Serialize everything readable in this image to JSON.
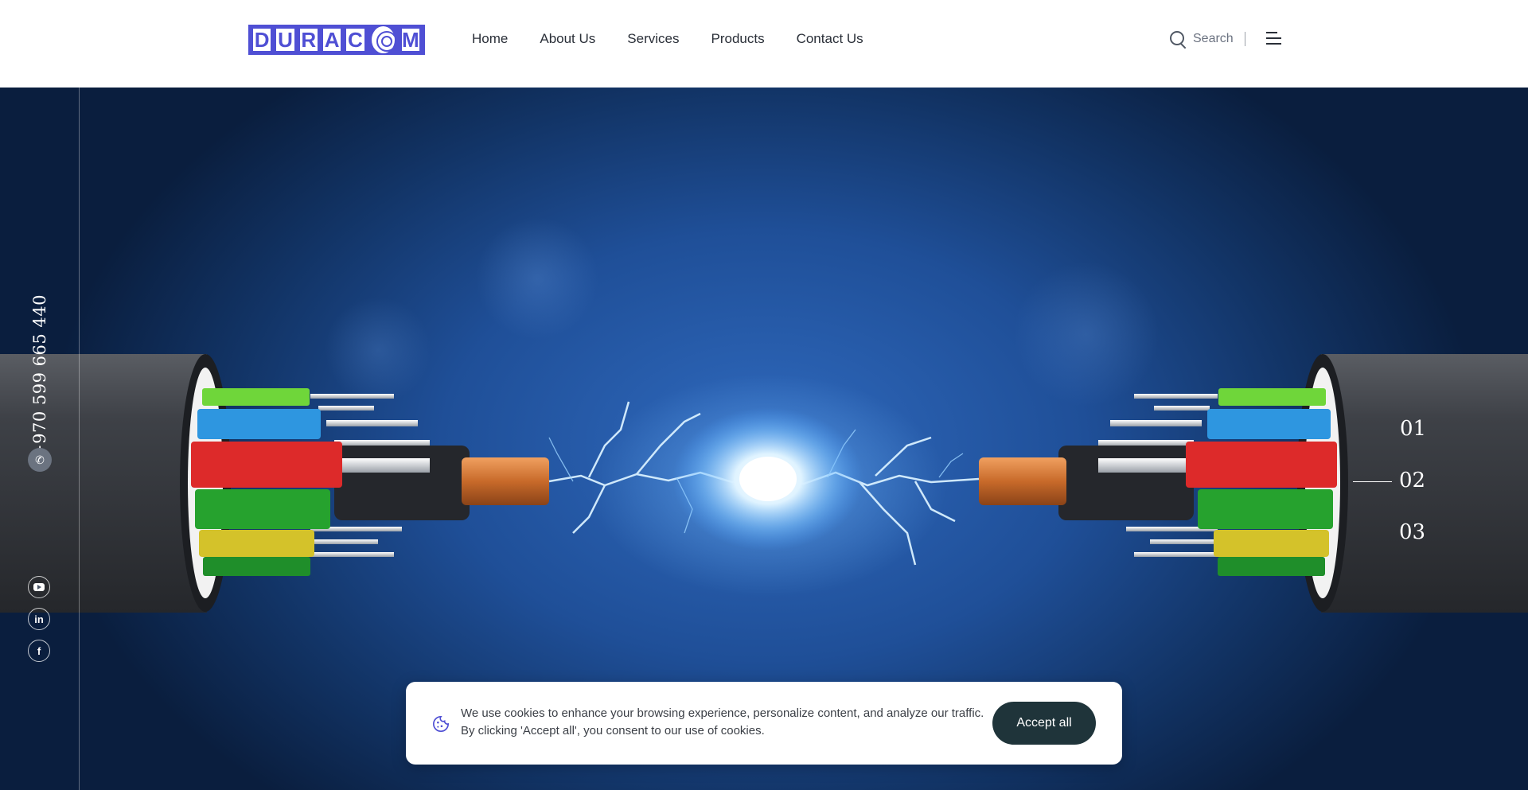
{
  "brand": {
    "logo_letters": [
      "D",
      "U",
      "R",
      "A",
      "C",
      "M"
    ],
    "logo_text": "DURACOM",
    "logo_color": "#4f4fd4"
  },
  "nav": {
    "items": [
      {
        "label": "Home"
      },
      {
        "label": "About Us"
      },
      {
        "label": "Services"
      },
      {
        "label": "Products"
      },
      {
        "label": "Contact Us"
      }
    ]
  },
  "search": {
    "label": "Search",
    "icon": "search-icon"
  },
  "menu": {
    "icon": "hamburger-menu-icon"
  },
  "sidebar": {
    "phone": "+970 599 665 440",
    "phone_icon": "phone-icon",
    "social": [
      {
        "name": "youtube",
        "icon": "youtube-icon"
      },
      {
        "name": "linkedin",
        "icon": "linkedin-icon",
        "glyph": "in"
      },
      {
        "name": "facebook",
        "icon": "facebook-icon",
        "glyph": "f"
      }
    ]
  },
  "hero": {
    "image": "fiber-optic-cables-electric-spark",
    "slides": [
      "01",
      "02",
      "03"
    ],
    "active_slide": "02"
  },
  "cookie_banner": {
    "icon": "cookie-icon",
    "text_line1": "We use cookies to enhance your browsing experience, personalize content, and analyze our traffic.",
    "text_line2": "By clicking 'Accept all', you consent to our use of cookies.",
    "accept_label": "Accept all"
  },
  "colors": {
    "accent": "#4f4fd4",
    "button_dark": "#1f343a",
    "hero_blue": "#1f4f98"
  }
}
